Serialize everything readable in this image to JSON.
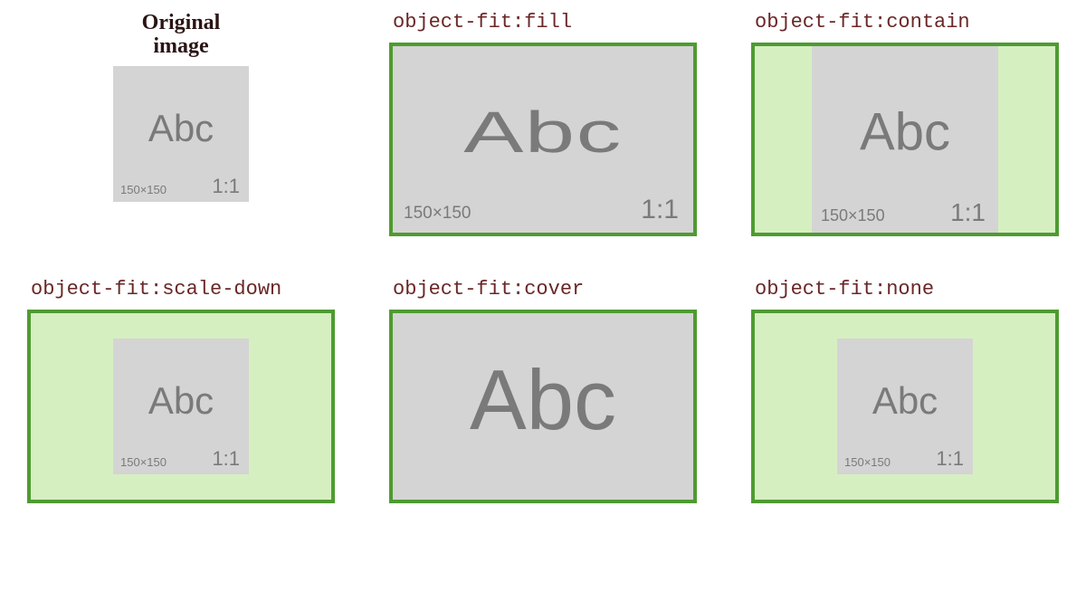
{
  "placeholder": {
    "center_text": "Abc",
    "dims_text": "150×150",
    "ratio_text": "1:1",
    "natural_width": 150,
    "natural_height": 150
  },
  "cells": {
    "original": {
      "title_line1": "Original",
      "title_line2": "image"
    },
    "fill": {
      "title": "object-fit:fill"
    },
    "contain": {
      "title": "object-fit:contain"
    },
    "scale_down": {
      "title": "object-fit:scale-down"
    },
    "cover": {
      "title": "object-fit:cover"
    },
    "none": {
      "title": "object-fit:none"
    }
  }
}
